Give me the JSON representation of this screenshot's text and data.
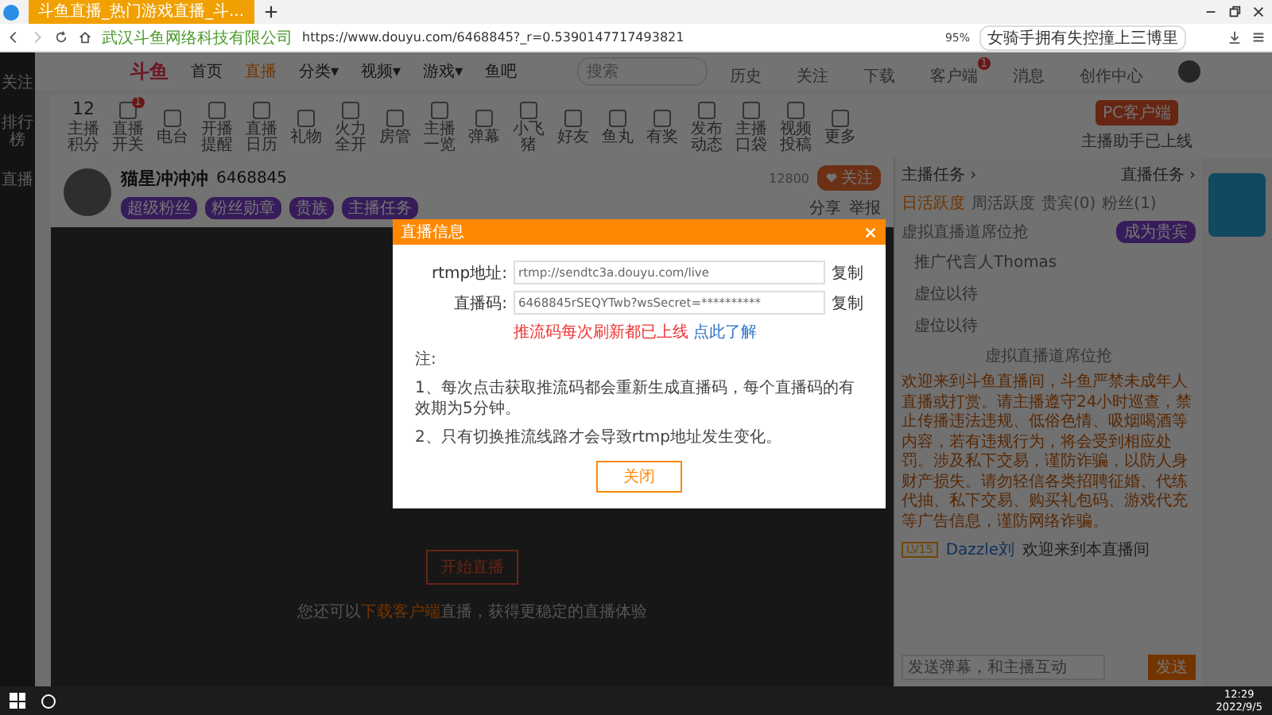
{
  "browser": {
    "tab_title": "斗鱼直播_热门游戏直播_斗...",
    "zoom": "95%",
    "site_owner": "武汉斗鱼网络科技有限公司",
    "url": "https://www.douyu.com/6468845?_r=0.5390147717493821",
    "search": "女骑手拥有失控撞上三博里"
  },
  "nav": {
    "logo": "斗鱼",
    "items": [
      {
        "label": "首页",
        "selected": false
      },
      {
        "label": "直播",
        "selected": true
      },
      {
        "label": "分类▾",
        "selected": false
      },
      {
        "label": "视频▾",
        "selected": false
      },
      {
        "label": "游戏▾",
        "selected": false
      },
      {
        "label": "鱼吧",
        "selected": false
      }
    ],
    "search_placeholder": "搜索",
    "actions": [
      {
        "label": "历史"
      },
      {
        "label": "关注"
      },
      {
        "label": "下载"
      },
      {
        "label": "客户端",
        "badge": "1"
      },
      {
        "label": "消息"
      },
      {
        "label": "创作中心"
      }
    ]
  },
  "sidebar": [
    "关注",
    "排行榜",
    "直播"
  ],
  "toolbar": {
    "points": "12",
    "points_label": "主播积分",
    "tools": [
      {
        "label": "直播开关",
        "badge": "1"
      },
      {
        "label": "电台"
      },
      {
        "label": "开播提醒"
      },
      {
        "label": "直播日历"
      },
      {
        "label": "礼物"
      },
      {
        "label": "火力全开"
      },
      {
        "label": "房管"
      },
      {
        "label": "主播一览"
      },
      {
        "label": "弹幕"
      },
      {
        "label": "小飞猪"
      },
      {
        "label": "好友"
      },
      {
        "label": "鱼丸"
      },
      {
        "label": "有奖"
      },
      {
        "label": "发布动态"
      },
      {
        "label": "主播口袋"
      },
      {
        "label": "视频投稿"
      },
      {
        "label": "更多"
      }
    ],
    "pc_button": "PC客户端",
    "pc_note": "主播助手已上线"
  },
  "streamer": {
    "name": "猫星冲冲冲",
    "room": "6468845",
    "follow_count": "12800",
    "follow": "关注",
    "share": "分享",
    "report": "举报",
    "badges": [
      "超级粉丝",
      "粉丝勋章",
      "贵族",
      "主播任务"
    ]
  },
  "modal": {
    "title": "直播信息",
    "fields": [
      {
        "label": "rtmp地址:",
        "value": "rtmp://sendtc3a.douyu.com/live",
        "action": "复制"
      },
      {
        "label": "直播码:",
        "value": "6468845rSEQYTwb?wsSecret=**********",
        "action": "复制"
      }
    ],
    "warning": "推流码每次刷新都已上线",
    "warning_link": "点此了解",
    "notes": [
      "注:",
      "1、每次点击获取推流码都会重新生成直播码，每个直播码的有效期为5分钟。",
      "2、只有切换推流线路才会导致rtmp地址发生变化。"
    ],
    "close": "关闭"
  },
  "video": {
    "start": "开始直播",
    "tip_before": "您还可以",
    "tip_link": "下载客户端",
    "tip_after": "直播，获得更稳定的直播体验"
  },
  "panel": {
    "links": [
      "主播任务 ›",
      "直播任务 ›"
    ],
    "tabs": [
      {
        "label": "日活跃度",
        "selected": true
      },
      {
        "label": "周活跃度",
        "selected": false
      },
      {
        "label": "贵宾(0)",
        "selected": false
      },
      {
        "label": "粉丝(1)",
        "selected": false
      }
    ],
    "rank_title": "虚拟直播道席位抢",
    "rank_button": "成为贵宾",
    "users": [
      "推广代言人Thomas",
      "虚位以待",
      "虚位以待"
    ],
    "rank_footer": "虚拟直播道席位抢",
    "notice": "欢迎来到斗鱼直播间，斗鱼严禁未成年人直播或打赏。请主播遵守24小时巡查，禁止传播违法违规、低俗色情、吸烟喝酒等内容，若有违规行为，将会受到相应处罚。涉及私下交易，谨防诈骗，以防人身财产损失。请勿轻信各类招聘征婚、代练代抽、私下交易、购买礼包码、游戏代充等广告信息，谨防网络诈骗。",
    "chat": [
      {
        "level": "LV15",
        "user": "Dazzle刘",
        "text": "欢迎来到本直播间"
      }
    ],
    "input_placeholder": "发送弹幕，和主播互动",
    "send": "发送"
  },
  "taskbar": {
    "time": "12:29",
    "date": "2022/9/5"
  }
}
